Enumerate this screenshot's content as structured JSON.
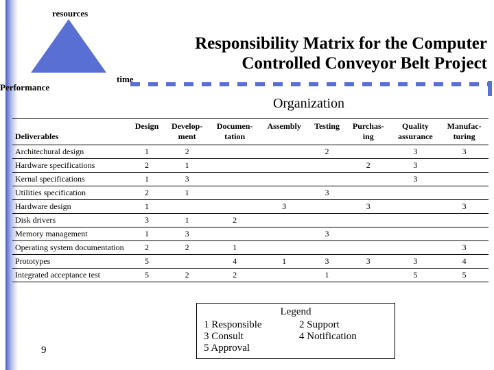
{
  "triangle": {
    "resources": "resources",
    "time": "time",
    "performance": "Performance"
  },
  "title_line1": "Responsibility Matrix for the Computer",
  "title_line2": "Controlled Conveyor Belt Project",
  "org_title": "Organization",
  "headers": {
    "deliverables": "Deliverables",
    "c1": "Design",
    "c2a": "Develop-",
    "c2b": "ment",
    "c3a": "Documen-",
    "c3b": "tation",
    "c4": "Assembly",
    "c5": "Testing",
    "c6a": "Purchas-",
    "c6b": "ing",
    "c7a": "Quality",
    "c7b": "assurance",
    "c8a": "Manufac-",
    "c8b": "turing"
  },
  "rows": [
    {
      "label": "Architechural design",
      "v": [
        "1",
        "2",
        "",
        "",
        "2",
        "",
        "3",
        "3"
      ]
    },
    {
      "label": "Hardware specifications",
      "v": [
        "2",
        "1",
        "",
        "",
        "",
        "2",
        "3",
        ""
      ]
    },
    {
      "label": "Kernal specifications",
      "v": [
        "1",
        "3",
        "",
        "",
        "",
        "",
        "3",
        ""
      ]
    },
    {
      "label": "Utilities specification",
      "v": [
        "2",
        "1",
        "",
        "",
        "3",
        "",
        "",
        ""
      ]
    },
    {
      "label": "Hardware design",
      "v": [
        "1",
        "",
        "",
        "3",
        "",
        "3",
        "",
        "3"
      ]
    },
    {
      "label": "Disk drivers",
      "v": [
        "3",
        "1",
        "2",
        "",
        "",
        "",
        "",
        ""
      ]
    },
    {
      "label": "Memory management",
      "v": [
        "1",
        "3",
        "",
        "",
        "3",
        "",
        "",
        ""
      ]
    },
    {
      "label": "Operating system documentation",
      "v": [
        "2",
        "2",
        "1",
        "",
        "",
        "",
        "",
        "3"
      ]
    },
    {
      "label": "Prototypes",
      "v": [
        "5",
        "",
        "4",
        "1",
        "3",
        "3",
        "3",
        "4"
      ]
    },
    {
      "label": "Integrated acceptance test",
      "v": [
        "5",
        "2",
        "2",
        "",
        "1",
        "",
        "5",
        "5"
      ]
    }
  ],
  "legend": {
    "title": "Legend",
    "i1": "1  Responsible",
    "i2": "2  Support",
    "i3": "3  Consult",
    "i4": "4  Notification",
    "i5": "5  Approval"
  },
  "slide_number": "9"
}
